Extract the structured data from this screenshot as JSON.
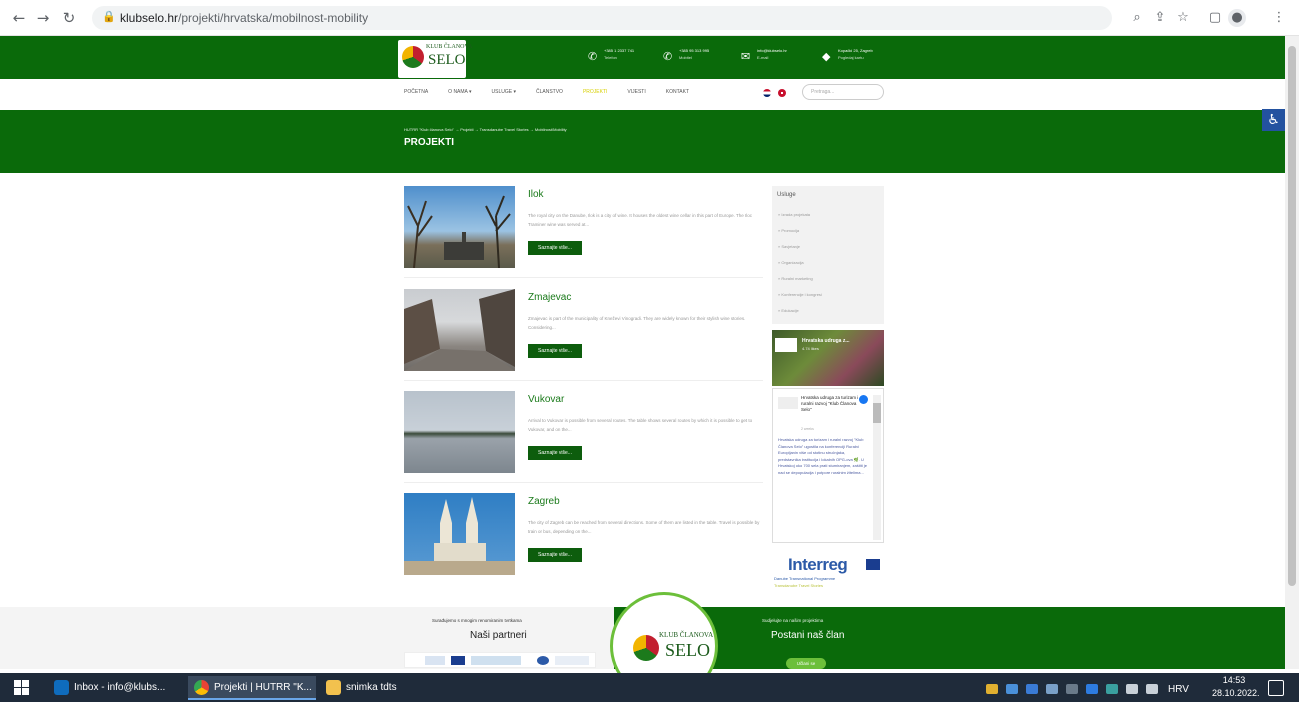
{
  "browser": {
    "url_domain": "klubselo.hr",
    "url_path": "/projekti/hrvatska/mobilnost-mobility"
  },
  "site": {
    "logo_line1": "KLUB ČLANOVA",
    "logo_line2": "SELO",
    "contacts": [
      {
        "icon": "phone-icon",
        "line1": "+385 1 2337 741",
        "line2": "Telefon"
      },
      {
        "icon": "phone-icon",
        "line1": "+385 95 313 995",
        "line2": "Mobitel"
      },
      {
        "icon": "mail-icon",
        "line1": "info@klubselo.hr",
        "line2": "E-mail"
      },
      {
        "icon": "location-icon",
        "line1": "Kopački 25, Zagreb",
        "line2": "Pogledaj kartu"
      }
    ],
    "menu": [
      "POČETNA",
      "O NAMA ▾",
      "USLUGE ▾",
      "ČLANSTVO",
      "PROJEKTI",
      "VIJESTI",
      "KONTAKT"
    ],
    "search_placeholder": "Pretraga..."
  },
  "hero": {
    "breadcrumb": "HUTRR \"Klub članova Selo\"  →  Projekti  →  Transdanube Travel Stories  →  Mobilnost/Mobility",
    "title": "PROJEKTI"
  },
  "projects": [
    {
      "title": "Ilok",
      "desc": "The royal city on the Danube, Ilok is a city of wine. It houses the oldest wine cellar in this part of Europe. The Iloc Traminer wine was served at...",
      "button": "Saznajte više..."
    },
    {
      "title": "Zmajevac",
      "desc": "Zmajevac is part of the municipality of Kneževi Vinogradi. They are widely known for their stylish wine stories. Considering...",
      "button": "Saznajte više..."
    },
    {
      "title": "Vukovar",
      "desc": "Arrival to Vukovar is possible from several routes. The table shows several routes by which it is possible to get to Vukovar, and on the...",
      "button": "Saznajte više..."
    },
    {
      "title": "Zagreb",
      "desc": "The city of Zagreb can be reached from several directions. Some of them are listed in the table. Travel is possible by train or bus, depending on the...",
      "button": "Saznajte više..."
    }
  ],
  "sidebar": {
    "heading": "Usluge",
    "items": [
      "» Izrada projekata",
      "» Promocija",
      "» Savjetanje",
      "» Organizacija",
      "» Ruralni marketing",
      "» Konferencije i kongresi",
      "» Edukacije"
    ],
    "fb_name": "Hrvatska udruga z...",
    "fb_likes": "4.74 likes",
    "fb_post_header": "Hrvatska udruga za turizam i ruralni razvoj \"Klub Članova Selo\"",
    "fb_post_time": "2 weeks",
    "fb_post_body": "Hrvatska udruga za turizam i ruralni razvoj \"Klub Članova Selo\" ugostila na konferenciji Ruralni Europljanin više od stotinu stručnjaka, predstavnika institucija i lokalnih OPG-ova 🌿. U Hrvatskoj oko 700 sela prati stumiranjem, zaštiti je nad se depopulacija i potpore ruralnim žitelima...",
    "interreg": "Interreg",
    "interreg_line2": "Danube Transnational Programme",
    "interreg_line3": "Transdanube Travel Stories"
  },
  "footer": {
    "left_small": "Surađujemo s mnogim renomiranim tvrtkama",
    "left_big": "Naši partneri",
    "right_small": "Sudjelujte na našim projektima",
    "right_big": "Postani naš član",
    "right_button": "Učlani se"
  },
  "taskbar": {
    "items": [
      "Inbox - info@klubs...",
      "Projekti | HUTRR \"K...",
      "snimka tdts"
    ],
    "lang": "HRV",
    "time": "14:53",
    "date": "28.10.2022."
  }
}
